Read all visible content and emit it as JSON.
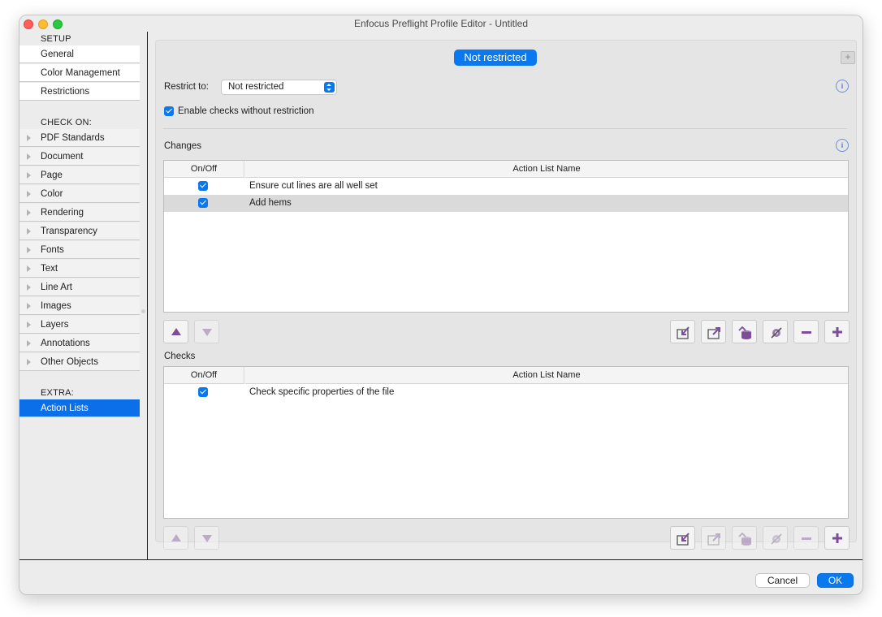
{
  "window": {
    "title": "Enfocus Preflight Profile Editor - Untitled"
  },
  "sidebar": {
    "setup_heading": "SETUP",
    "setup_items": [
      "General",
      "Color Management",
      "Restrictions"
    ],
    "check_heading": "CHECK ON:",
    "check_items": [
      "PDF Standards",
      "Document",
      "Page",
      "Color",
      "Rendering",
      "Transparency",
      "Fonts",
      "Text",
      "Line Art",
      "Images",
      "Layers",
      "Annotations",
      "Other Objects"
    ],
    "extra_heading": "EXTRA:",
    "extra_items": [
      "Action Lists"
    ],
    "selected": "Action Lists"
  },
  "main": {
    "status_pill": "Not restricted",
    "restrict_label": "Restrict to:",
    "restrict_value": "Not restricted",
    "enable_checks_label": "Enable checks without restriction",
    "enable_checks_checked": true,
    "info_icon_text": "i",
    "corner_button_text": "+",
    "changes": {
      "title": "Changes",
      "columns": [
        "On/Off",
        "Action List Name"
      ],
      "rows": [
        {
          "checked": true,
          "name": "Ensure cut lines are all well set"
        },
        {
          "checked": true,
          "name": "Add hems"
        }
      ]
    },
    "checks": {
      "title": "Checks",
      "columns": [
        "On/Off",
        "Action List Name"
      ],
      "rows": [
        {
          "checked": true,
          "name": "Check specific properties of the file"
        }
      ]
    }
  },
  "footer": {
    "cancel_label": "Cancel",
    "ok_label": "OK"
  },
  "colors": {
    "accent": "#0a79f0",
    "selected": "#0a6fe9",
    "icon_purple": "#7d4d9a"
  }
}
